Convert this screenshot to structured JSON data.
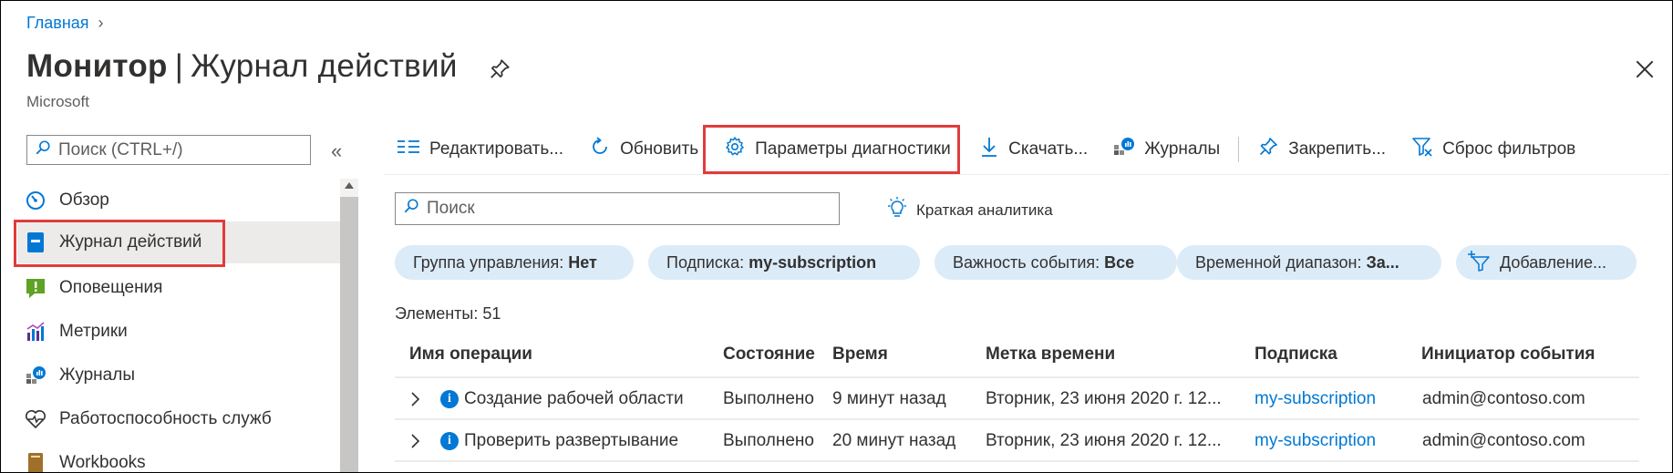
{
  "breadcrumb": {
    "home": "Главная"
  },
  "header": {
    "title_main": "Монитор",
    "title_separator": "|",
    "title_sub": "Журнал действий",
    "publisher": "Microsoft"
  },
  "sidebar": {
    "search_placeholder": "Поиск (CTRL+/)",
    "collapse_glyph": "«",
    "items": [
      {
        "label": "Обзор",
        "icon": "overview-gauge-icon"
      },
      {
        "label": "Журнал действий",
        "icon": "activity-log-icon",
        "active": true
      },
      {
        "label": "Оповещения",
        "icon": "alerts-icon"
      },
      {
        "label": "Метрики",
        "icon": "metrics-icon"
      },
      {
        "label": "Журналы",
        "icon": "logs-icon"
      },
      {
        "label": "Работоспособность служб",
        "icon": "service-health-heart-icon"
      },
      {
        "label": "Workbooks",
        "icon": "workbooks-icon"
      }
    ]
  },
  "toolbar": {
    "edit": "Редактировать...",
    "refresh": "Обновить",
    "diagnostics": "Параметры диагностики",
    "download": "Скачать...",
    "logs": "Журналы",
    "pin": "Закрепить...",
    "reset_filters": "Сброс фильтров"
  },
  "filter_search": {
    "placeholder": "Поиск"
  },
  "insights": {
    "label": "Краткая аналитика"
  },
  "filters": [
    {
      "key": "Группа управления:",
      "value": "Нет"
    },
    {
      "key": "Подписка:",
      "value": "my-subscription"
    },
    {
      "key": "Важность события:",
      "value": "Все"
    },
    {
      "key": "Временной диапазон:",
      "value": "За..."
    },
    {
      "add_label": "Добавление..."
    }
  ],
  "count_label": "Элементы: 51",
  "table": {
    "headers": [
      "Имя операции",
      "Состояние",
      "Время",
      "Метка времени",
      "Подписка",
      "Инициатор события"
    ],
    "rows": [
      [
        "Создание рабочей области",
        "Выполнено",
        "9 минут назад",
        "Вторник, 23 июня 2020 г. 12...",
        "my-subscription",
        "admin@contoso.com"
      ],
      [
        "Проверить развертывание",
        "Выполнено",
        "20 минут назад",
        "Вторник, 23 июня 2020 г. 12...",
        "my-subscription",
        "admin@contoso.com"
      ]
    ]
  },
  "colors": {
    "accent": "#0078d4",
    "highlight": "#e03c3c",
    "pill": "#dcebf8"
  }
}
